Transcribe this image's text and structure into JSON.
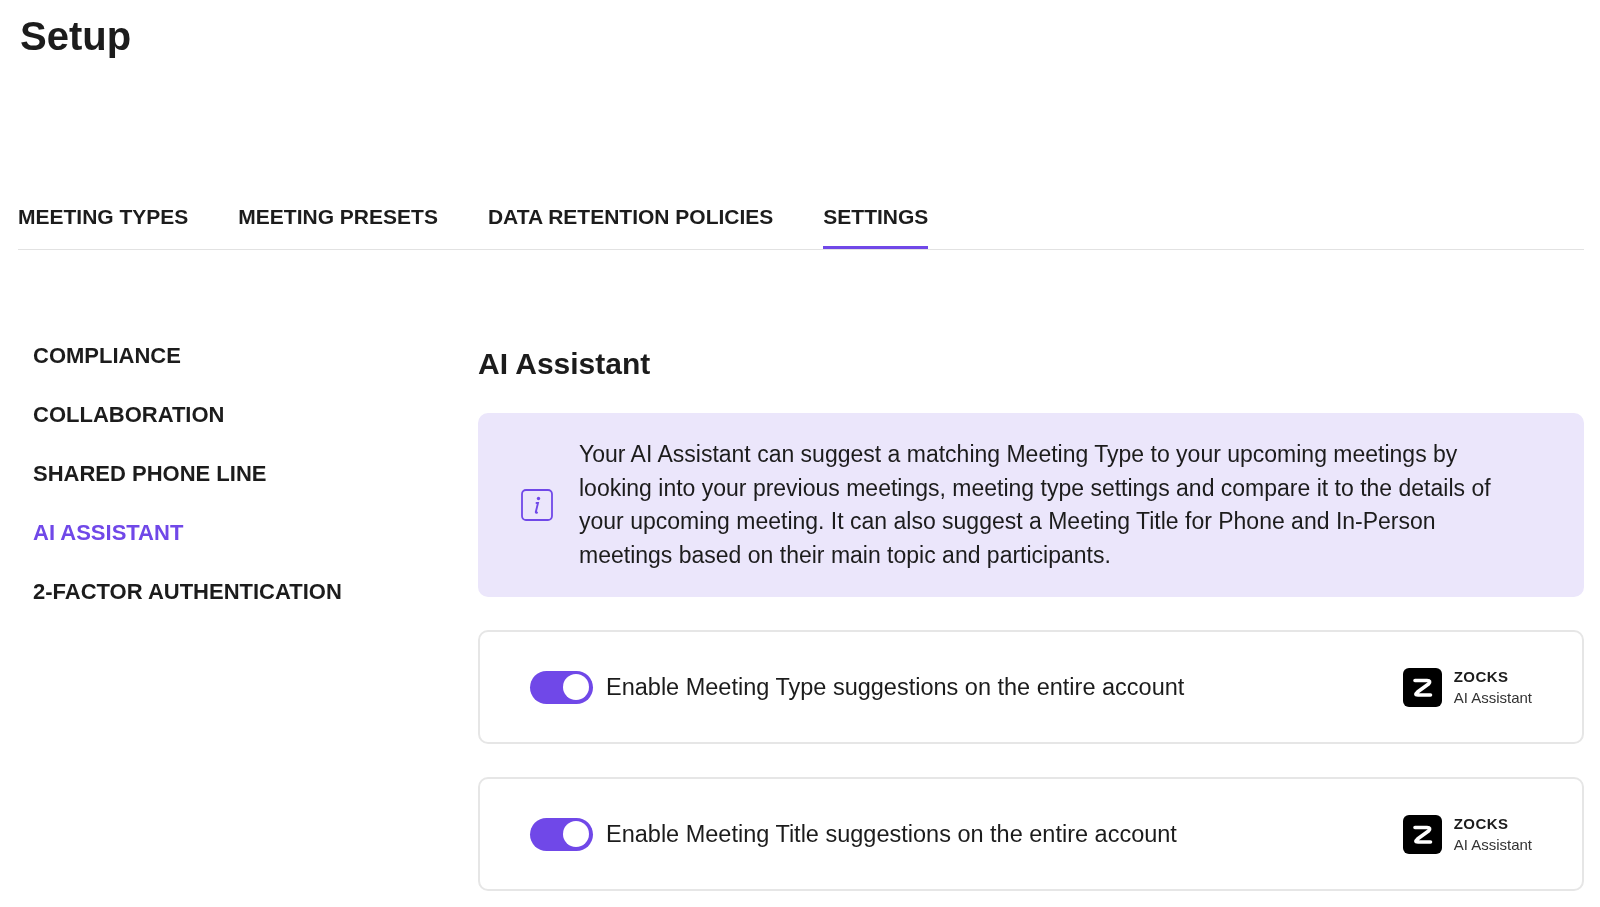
{
  "page": {
    "title": "Setup"
  },
  "tabs": [
    {
      "label": "MEETING TYPES",
      "selected": false
    },
    {
      "label": "MEETING PRESETS",
      "selected": false
    },
    {
      "label": "DATA RETENTION POLICIES",
      "selected": false
    },
    {
      "label": "SETTINGS",
      "selected": true
    }
  ],
  "sidebar": {
    "items": [
      {
        "label": "COMPLIANCE",
        "selected": false
      },
      {
        "label": "COLLABORATION",
        "selected": false
      },
      {
        "label": "SHARED PHONE LINE",
        "selected": false
      },
      {
        "label": "AI ASSISTANT",
        "selected": true
      },
      {
        "label": "2-FACTOR AUTHENTICATION",
        "selected": false
      }
    ]
  },
  "section": {
    "title": "AI Assistant",
    "info": "Your AI Assistant can suggest a matching Meeting Type to your upcoming meetings by looking into your previous meetings, meeting type settings and compare it to the details of your upcoming meeting. It can also suggest a Meeting Title for Phone and In-Person meetings based on their main topic and participants.",
    "settings": [
      {
        "label": "Enable Meeting Type suggestions on the entire account",
        "on": true,
        "badge": {
          "brand": "ZOCKS",
          "subtitle": "AI Assistant"
        }
      },
      {
        "label": "Enable Meeting Title suggestions on the entire account",
        "on": true,
        "badge": {
          "brand": "ZOCKS",
          "subtitle": "AI Assistant"
        }
      }
    ]
  }
}
